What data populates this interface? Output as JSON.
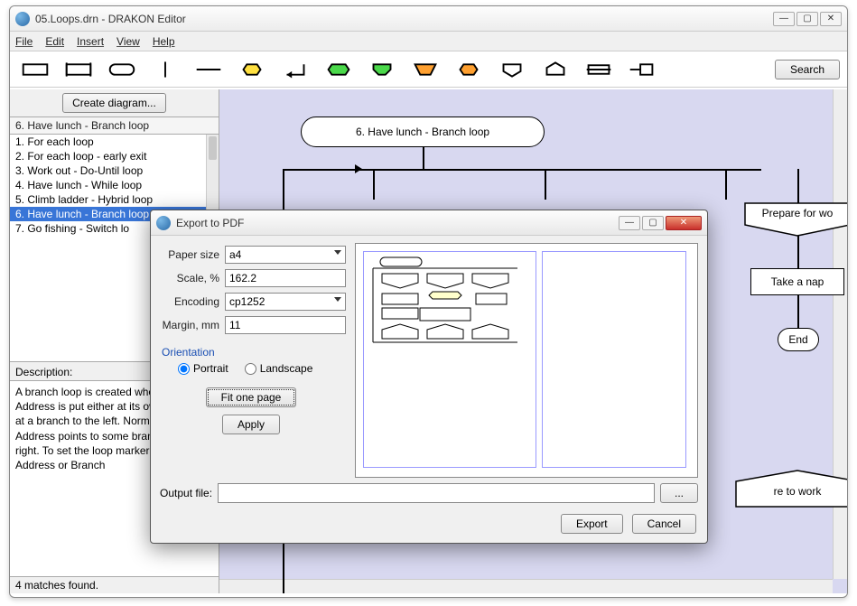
{
  "window": {
    "title": "05.Loops.drn - DRAKON Editor",
    "min": "—",
    "max": "▢",
    "close": "✕"
  },
  "menu": {
    "file": "File",
    "edit": "Edit",
    "insert": "Insert",
    "view": "View",
    "help": "Help"
  },
  "toolbar": {
    "search": "Search"
  },
  "sidebar": {
    "create": "Create diagram...",
    "header": "6. Have lunch - Branch loop",
    "items": [
      "1. For each loop",
      "2. For each loop - early exit",
      "3. Work out - Do-Until loop",
      "4. Have lunch - While loop",
      "5. Climb ladder - Hybrid loop",
      "6. Have lunch - Branch loop",
      "7. Go fishing - Switch lo"
    ],
    "selectedIndex": 5,
    "descLabel": "Description:",
    "desc": "A branch loop is created when an Address is put either at its own branch or at a branch to the left. Normally, an Address points to some branch at the right.\n\nTo set the loop marker on an Address or Branch",
    "status": "4 matches found."
  },
  "canvas": {
    "title": "6. Have lunch - Branch loop",
    "prepare": "Prepare for wo",
    "take_nap": "Take a nap",
    "end": "End",
    "return": "re to work"
  },
  "dialog": {
    "title": "Export to PDF",
    "labels": {
      "paper": "Paper size",
      "scale": "Scale, %",
      "encoding": "Encoding",
      "margin": "Margin, mm",
      "orientation": "Orientation",
      "portrait": "Portrait",
      "landscape": "Landscape",
      "fit": "Fit one page",
      "apply": "Apply",
      "output": "Output file:",
      "browse": "...",
      "export": "Export",
      "cancel": "Cancel"
    },
    "values": {
      "paper": "a4",
      "scale": "162.2",
      "encoding": "cp1252",
      "margin": "11",
      "orientation": "portrait",
      "output": ""
    }
  }
}
